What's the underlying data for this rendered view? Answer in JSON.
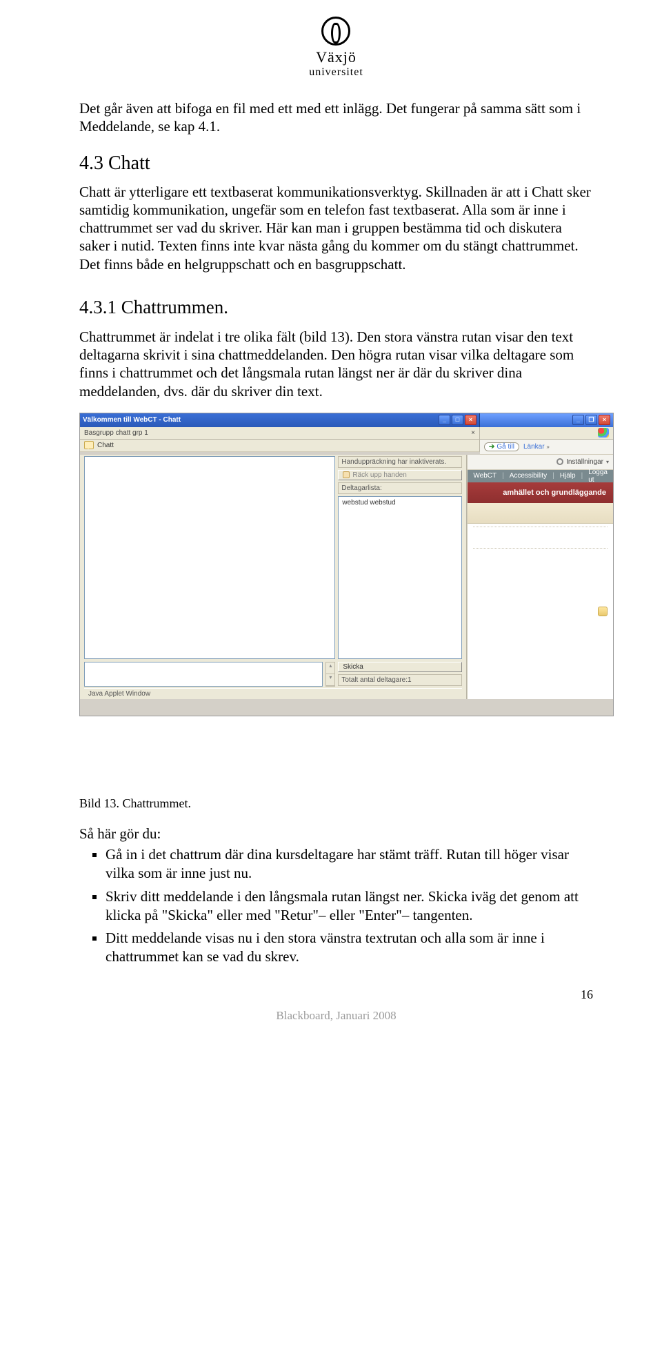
{
  "logo": {
    "line1": "Växjö",
    "line2": "universitet"
  },
  "intro_para": "Det går även att bifoga en fil med ett med ett inlägg. Det fungerar på samma sätt som i Meddelande, se kap 4.1.",
  "section_heading": "4.3 Chatt",
  "section_body": "Chatt är ytterligare ett textbaserat kommunikationsverktyg. Skillnaden är att i Chatt sker samtidig kommunikation, ungefär som en telefon fast textbaserat. Alla som är inne i chattrummet ser vad du skriver. Här kan man i gruppen bestämma tid och diskutera saker i nutid. Texten finns inte kvar nästa gång du kommer om du stängt chattrummet. Det finns både en helgruppschatt och en basgruppschatt.",
  "subsection_heading": "4.3.1   Chattrummen.",
  "subsection_body": "Chattrummet är indelat i tre olika fält (bild 13). Den stora vänstra rutan visar den text deltagarna skrivit i sina chattmeddelanden. Den högra rutan visar vilka deltagare som finns i chattrummet och det långsmala rutan längst ner är där du skriver dina meddelanden, dvs. där du skriver din text.",
  "screenshot": {
    "window_title": "Välkommen till WebCT - Chatt",
    "subbar_left": "Basgrupp chatt grp 1",
    "chatt_label": "Chatt",
    "hand_msg": "Handuppräckning har inaktiverats.",
    "hand_btn": "Räck upp handen",
    "detlabel": "Deltagarlista:",
    "participant": "webstud webstud",
    "send_btn": "Skicka",
    "count_label": "Totalt antal deltagare:1",
    "status": "Java Applet Window",
    "go_btn": "Gå till",
    "links_label": "Länkar",
    "settings_label": "Inställningar",
    "tabs": [
      "WebCT",
      "Accessibility",
      "Hjälp",
      "Logga ut"
    ],
    "redband_text": "amhället och grundläggande",
    "close_x": "×"
  },
  "caption": "Bild 13. Chattrummet.",
  "howto_intro": "Så här gör du:",
  "howto_items": [
    "Gå in i det chattrum där dina kursdeltagare har stämt träff. Rutan till höger visar vilka som är inne just nu.",
    "Skriv ditt meddelande i den långsmala rutan längst ner. Skicka iväg det genom att klicka på \"Skicka\" eller med \"Retur\"– eller \"Enter\"– tangenten.",
    "Ditt meddelande visas nu i den stora vänstra textrutan och alla som är inne i chattrummet kan se vad du skrev."
  ],
  "page_number": "16",
  "footer": "Blackboard, Januari 2008"
}
